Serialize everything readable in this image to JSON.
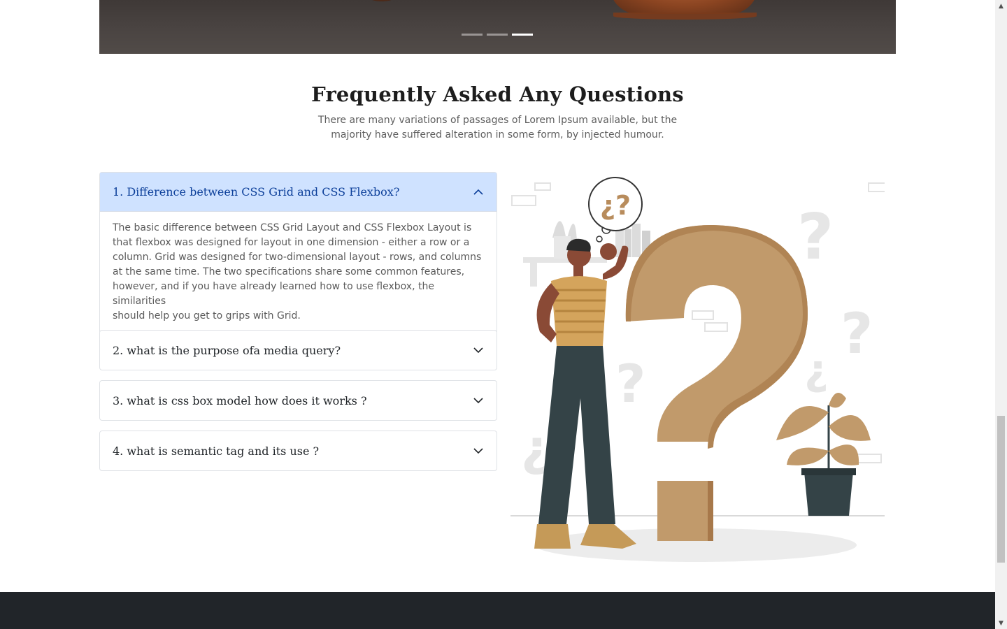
{
  "carousel": {
    "slide_count": 3,
    "active_slide": 3
  },
  "faq": {
    "title": "Frequently Asked Any Questions",
    "subtitle_line1": "There are many variations of passages of Lorem Ipsum available, but the",
    "subtitle_line2": "majority have suffered alteration in some form, by injected humour.",
    "items": [
      {
        "question": "1. Difference between CSS Grid and CSS Flexbox?",
        "expanded": true,
        "answer_lines": [
          "The basic difference between CSS Grid Layout and CSS Flexbox Layout is",
          "that flexbox was designed for layout in one dimension - either a row or a",
          "column. Grid was designed for two-dimensional layout - rows, and columns",
          "at the same time. The two specifications share some common features,",
          "however, and if you have already learned how to use flexbox, the similarities",
          "should help you get to grips with Grid."
        ]
      },
      {
        "question": "2. what is the purpose ofa media query?",
        "expanded": false
      },
      {
        "question": "3. what is css box model how does it works ?",
        "expanded": false
      },
      {
        "question": "4. what is semantic tag and its use ?",
        "expanded": false
      }
    ]
  },
  "illustration": {
    "thought_bubble_text": "¿?"
  },
  "colors": {
    "accent_open_bg": "#cfe2ff",
    "accent_open_text": "#0c3f9a",
    "question_mark": "#b88c5c",
    "footer": "#212529"
  },
  "icons": {
    "open": "chevron-up-icon",
    "closed": "chevron-down-icon"
  }
}
